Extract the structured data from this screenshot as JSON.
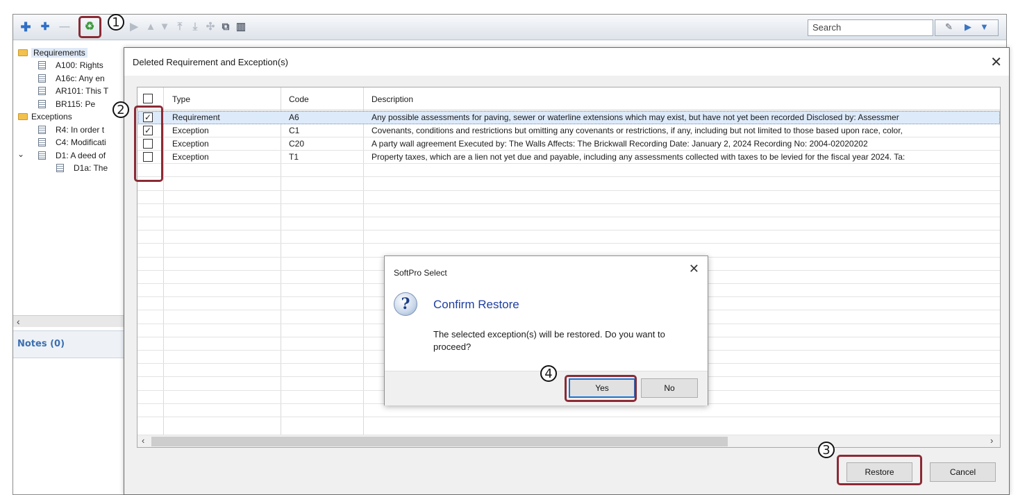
{
  "toolbar": {
    "search_placeholder": "Search"
  },
  "tree": {
    "requirements_label": "Requirements",
    "requirements": [
      "A100: Rights",
      "A16c: Any en",
      "AR101: This T",
      "BR115: Pe"
    ],
    "exceptions_label": "Exceptions",
    "exceptions": [
      "R4: In order t",
      "C4: Modificati",
      "D1: A deed of",
      "D1a: The"
    ]
  },
  "notes_label": "Notes (0)",
  "dialog": {
    "title": "Deleted Requirement and Exception(s)",
    "columns": [
      "Type",
      "Code",
      "Description"
    ],
    "rows": [
      {
        "checked": true,
        "type": "Requirement",
        "code": "A6",
        "description": "Any possible assessments for paving, sewer or waterline extensions which may exist, but have not yet been recorded    Disclosed by:  Assessmer"
      },
      {
        "checked": true,
        "type": "Exception",
        "code": "C1",
        "description": "Covenants, conditions and restrictions but omitting any covenants or restrictions, if any, including but not limited to those based upon race, color,"
      },
      {
        "checked": false,
        "type": "Exception",
        "code": "C20",
        "description": "A party wall agreement    Executed by:  The Walls   Affects:  The Brickwall   Recording Date:  January 2, 2024  Recording No:  2004-02020202"
      },
      {
        "checked": false,
        "type": "Exception",
        "code": "T1",
        "description": "Property taxes, which are a lien not yet due and payable, including any assessments collected with taxes to be levied for the fiscal year 2024. Ta:"
      }
    ],
    "restore_label": "Restore",
    "cancel_label": "Cancel"
  },
  "confirm": {
    "title": "SoftPro Select",
    "heading": "Confirm Restore",
    "message": "The selected exception(s) will be restored. Do you want to proceed?",
    "yes_label": "Yes",
    "no_label": "No"
  },
  "callouts": [
    "1",
    "2",
    "3",
    "4"
  ]
}
